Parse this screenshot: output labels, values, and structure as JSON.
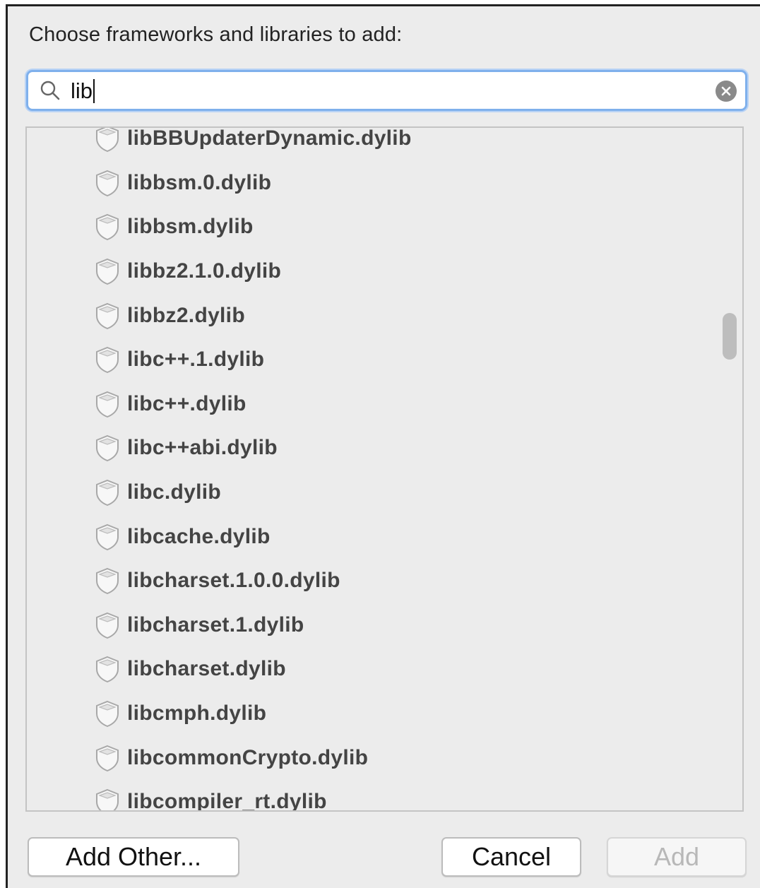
{
  "dialog": {
    "prompt": "Choose frameworks and libraries to add:"
  },
  "search": {
    "value": "lib",
    "placeholder": ""
  },
  "library_list": [
    "libBBUpdaterDynamic.dylib",
    "libbsm.0.dylib",
    "libbsm.dylib",
    "libbz2.1.0.dylib",
    "libbz2.dylib",
    "libc++.1.dylib",
    "libc++.dylib",
    "libc++abi.dylib",
    "libc.dylib",
    "libcache.dylib",
    "libcharset.1.0.0.dylib",
    "libcharset.1.dylib",
    "libcharset.dylib",
    "libcmph.dylib",
    "libcommonCrypto.dylib",
    "libcompiler_rt.dylib"
  ],
  "buttons": {
    "add_other": "Add Other...",
    "cancel": "Cancel",
    "add": "Add"
  },
  "icons": {
    "search": "search-icon",
    "clear": "clear-search-icon",
    "library": "library-icon"
  },
  "colors": {
    "focus_ring": "#7fb0ec",
    "background": "#ececec"
  }
}
